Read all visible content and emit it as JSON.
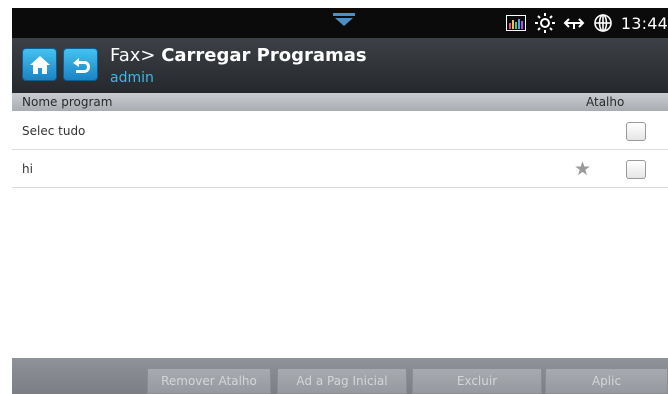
{
  "status_bar": {
    "time": "13:44",
    "icons": [
      "notification-drawer-icon",
      "signal-bars-icon",
      "brightness-icon",
      "network-icon",
      "globe-icon"
    ]
  },
  "header": {
    "breadcrumb_prefix": "Fax> ",
    "title": "Carregar Programas",
    "user": "admin",
    "accent": "#3db8ec"
  },
  "columns": {
    "name": "Nome program",
    "shortcut": "Atalho"
  },
  "rows": [
    {
      "label": "Selec tudo"
    },
    {
      "label": "hi"
    }
  ],
  "actions": {
    "remove_shortcut": "Remover Atalho",
    "add_home": "Ad a Pag Inicial",
    "delete": "Excluir",
    "apply": "Aplic"
  }
}
